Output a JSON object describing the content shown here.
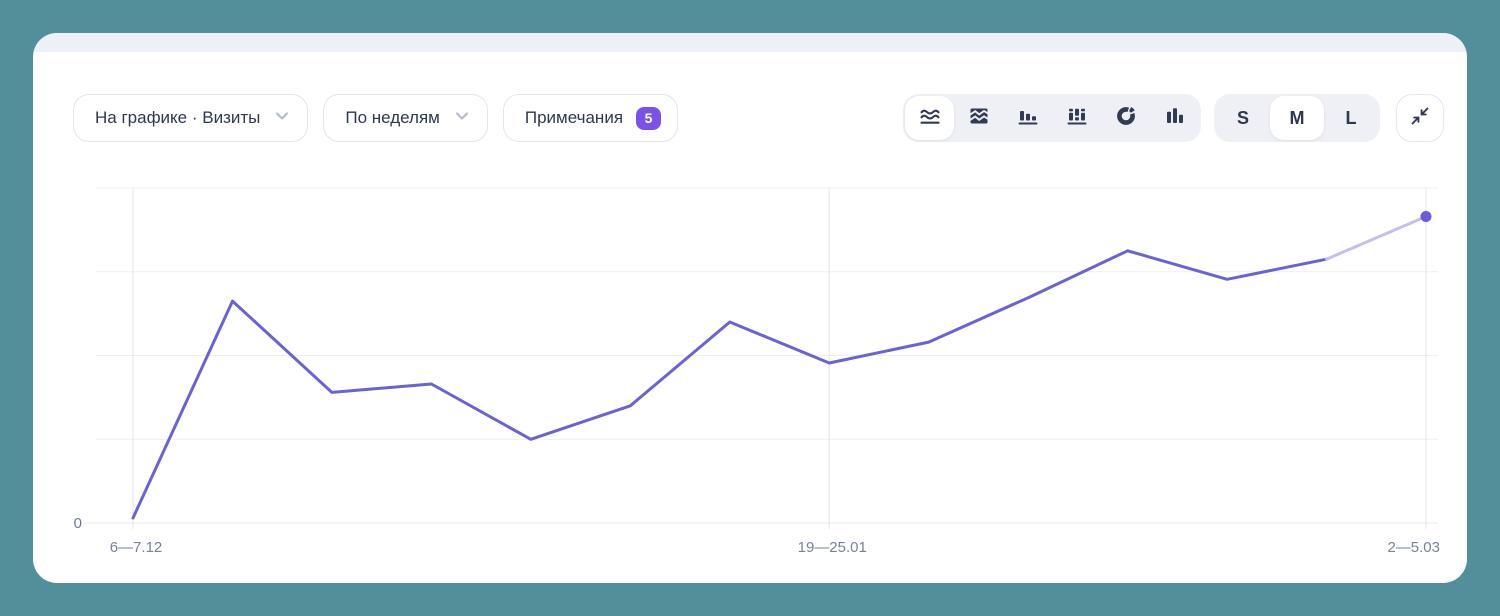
{
  "page": {
    "background_color": "#538f9b"
  },
  "controls": {
    "metric_dropdown": {
      "label": "На графике · Визиты",
      "icon": "chevron-down-icon"
    },
    "grouping_dropdown": {
      "label": "По неделям",
      "icon": "chevron-down-icon"
    },
    "notes_button": {
      "label": "Примечания",
      "badge": "5",
      "badge_color": "#7b51e9"
    },
    "chart_type_switcher": {
      "items": [
        {
          "icon": "line-chart-icon",
          "selected": true
        },
        {
          "icon": "stacked-area-chart-icon",
          "selected": false
        },
        {
          "icon": "bar-chart-icon",
          "selected": false
        },
        {
          "icon": "stacked-bar-chart-icon",
          "selected": false
        },
        {
          "icon": "pie-chart-icon",
          "selected": false
        },
        {
          "icon": "column-chart-icon",
          "selected": false
        }
      ]
    },
    "size_switcher": {
      "options": [
        "S",
        "M",
        "L"
      ],
      "selected": "M"
    },
    "collapse_button": {
      "icon": "collapse-icon"
    }
  },
  "chart_data": {
    "type": "line",
    "title": "",
    "series": [
      {
        "name": "Визиты",
        "values": [
          0.06,
          2.65,
          1.56,
          1.66,
          1.0,
          1.4,
          2.4,
          1.91,
          2.16,
          2.69,
          3.25,
          2.91,
          3.15,
          3.66
        ]
      }
    ],
    "x_tick_labels": [
      {
        "index": 0,
        "label": "6—7.12"
      },
      {
        "index": 7,
        "label": "19—25.01"
      },
      {
        "index": 13,
        "label": "2—5.03"
      }
    ],
    "y_tick_labels": [
      "0"
    ],
    "ylim": [
      0,
      4
    ],
    "grid": true,
    "legend": "none",
    "faded_tail_from_index": 12,
    "end_point_marker": true,
    "colors": {
      "line": "#6a62d6",
      "faded_tail": "#c4c0ee",
      "marker": "#695cdf",
      "gridline": "#edeff3",
      "vertical_gridline": "#e3e6eb",
      "axis_line": "#e8eaef",
      "axis_labels": "#76829b"
    }
  }
}
